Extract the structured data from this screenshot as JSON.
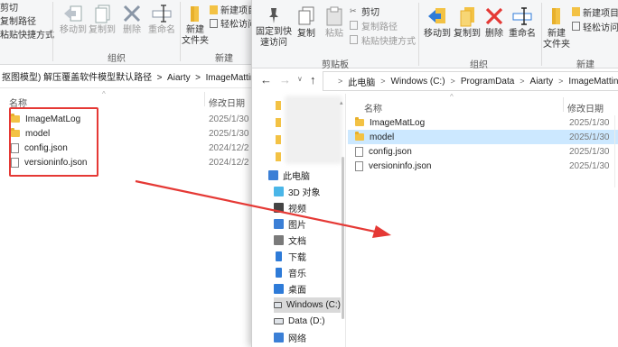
{
  "back_window": {
    "ribbon": {
      "top_items": [
        "剪切",
        "复制路径",
        "粘贴快捷方式"
      ],
      "move_to": "移动到",
      "copy_to": "复制到",
      "delete": "删除",
      "rename": "重命名",
      "new_item": "新建项目",
      "easy_access": "轻松访问",
      "new_folder": "新建\n文件夹",
      "group_organize": "组织",
      "group_new": "新建"
    },
    "address": "抠图模型) 解压覆盖软件模型默认路径  >  Aiarty  >  ImageMatting",
    "col_name": "名称",
    "col_date": "修改日期",
    "files": [
      {
        "name": "ImageMatLog",
        "type": "folder",
        "date": "2025/1/30"
      },
      {
        "name": "model",
        "type": "folder",
        "date": "2025/1/30"
      },
      {
        "name": "config.json",
        "type": "file",
        "date": "2024/12/2"
      },
      {
        "name": "versioninfo.json",
        "type": "file",
        "date": "2024/12/2"
      }
    ]
  },
  "front_window": {
    "ribbon": {
      "pin": "固定到快\n速访问",
      "copy": "复制",
      "paste": "粘贴",
      "cut": "剪切",
      "copy_path": "复制路径",
      "paste_shortcut": "粘贴快捷方式",
      "move_to": "移动到",
      "copy_to": "复制到",
      "delete": "删除",
      "rename": "重命名",
      "new_folder": "新建\n文件夹",
      "new_item": "新建项目",
      "easy_access": "轻松访问",
      "group_clipboard": "剪贴板",
      "group_organize": "组织",
      "group_new": "新建"
    },
    "breadcrumb": [
      "此电脑",
      "Windows (C:)",
      "ProgramData",
      "Aiarty",
      "ImageMatting"
    ],
    "col_name": "名称",
    "col_date": "修改日期",
    "files": [
      {
        "name": "ImageMatLog",
        "type": "folder",
        "date": "2025/1/30"
      },
      {
        "name": "model",
        "type": "folder",
        "date": "2025/1/30"
      },
      {
        "name": "config.json",
        "type": "file",
        "date": "2025/1/30"
      },
      {
        "name": "versioninfo.json",
        "type": "file",
        "date": "2025/1/30"
      }
    ],
    "nav": [
      {
        "label": "此电脑",
        "icon": "computer-icon",
        "color": "#3b7fd6"
      },
      {
        "label": "3D 对象",
        "icon": "3d-objects-icon",
        "color": "#4ab6e8"
      },
      {
        "label": "视频",
        "icon": "video-icon",
        "color": "#444444"
      },
      {
        "label": "图片",
        "icon": "pictures-icon",
        "color": "#3b7fd6"
      },
      {
        "label": "文档",
        "icon": "documents-icon",
        "color": "#7a7a7a"
      },
      {
        "label": "下载",
        "icon": "download-icon",
        "color": "#2e7bd8"
      },
      {
        "label": "音乐",
        "icon": "music-icon",
        "color": "#2e7bd8"
      },
      {
        "label": "桌面",
        "icon": "desktop-icon",
        "color": "#2e7bd8"
      },
      {
        "label": "Windows (C:)",
        "icon": "drive-icon",
        "color": "#5a5a5a"
      },
      {
        "label": "Data (D:)",
        "icon": "drive-icon",
        "color": "#5a5a5a"
      },
      {
        "label": "网络",
        "icon": "network-icon",
        "color": "#3b7fd6"
      }
    ]
  },
  "colors": {
    "highlight_box": "#e53935",
    "arrow": "#e53935",
    "selection": "#cce8ff"
  }
}
